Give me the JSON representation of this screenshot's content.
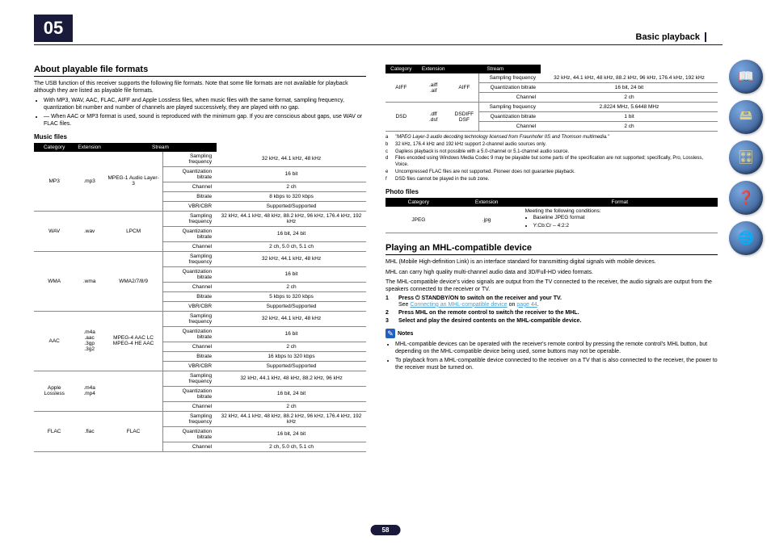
{
  "chapter": "05",
  "header_title": "Basic playback",
  "page_number": "58",
  "section1": {
    "title": "About playable file formats",
    "intro": "The USB function of this receiver supports the following file formats. Note that some file formats are not available for playback although they are listed as playable file formats.",
    "bullets": [
      "With MP3, WAV, AAC, FLAC, AIFF and Apple Lossless files, when music files with the same format, sampling frequency, quantization bit number and number of channels are played successively, they are played with no gap.",
      "When AAC or MP3 format is used, sound is reproduced with the minimum gap. If you are conscious about gaps, use WAV or FLAC files."
    ],
    "music_files": "Music files",
    "tbl_headers": {
      "cat": "Category",
      "ext": "Extension",
      "stream": "Stream",
      "format": "Format"
    },
    "labels": {
      "sf": "Sampling frequency",
      "qb": "Quantization bitrate",
      "ch": "Channel",
      "br": "Bitrate",
      "vc": "VBR/CBR"
    },
    "rows_left": [
      {
        "cat": "MP3\n<a>",
        "ext": ".mp3",
        "stream": "MPEG-1 Audio Layer-3",
        "d": [
          [
            "sf",
            "32 kHz, 44.1 kHz, 48 kHz"
          ],
          [
            "qb",
            "16 bit"
          ],
          [
            "ch",
            "2 ch"
          ],
          [
            "br",
            "8 kbps to 320 kbps"
          ],
          [
            "vc",
            "Supported/Supported"
          ]
        ]
      },
      {
        "cat": "WAV",
        "ext": ".wav",
        "stream": "LPCM",
        "d": [
          [
            "sf",
            "32 kHz, 44.1 kHz, 48 kHz, 88.2 kHz, 96 kHz, 176.4 kHz, 192 kHz"
          ],
          [
            "sf2",
            "<b>"
          ],
          [
            "qb",
            "16 bit, 24 bit"
          ],
          [
            "ch",
            "2 ch, 5.0 ch, 5.1 ch\n<c>"
          ]
        ]
      },
      {
        "cat": "WMA",
        "ext": ".wma",
        "stream": "WMA2/7/8/9\n<d>",
        "d": [
          [
            "sf",
            "32 kHz, 44.1 kHz, 48 kHz"
          ],
          [
            "qb",
            "16 bit"
          ],
          [
            "ch",
            "2 ch"
          ],
          [
            "br",
            "5 kbps to 320 kbps"
          ],
          [
            "vc",
            "Supported/Supported"
          ]
        ]
      },
      {
        "cat": "AAC",
        "ext": ".m4a\n.aac\n.3gp\n.3g2",
        "stream": "MPEG-4 AAC LC\nMPEG-4 HE AAC",
        "d": [
          [
            "sf",
            "32 kHz, 44.1 kHz, 48 kHz"
          ],
          [
            "qb",
            "16 bit"
          ],
          [
            "ch",
            "2 ch"
          ],
          [
            "br",
            "16 kbps to 320 kbps"
          ],
          [
            "vc",
            "Supported/Supported"
          ]
        ]
      },
      {
        "cat": "Apple Lossless",
        "ext": ".m4a\n.mp4",
        "stream": "",
        "d": [
          [
            "sf",
            "32 kHz, 44.1 kHz, 48 kHz, 88.2 kHz, 96 kHz"
          ],
          [
            "qb",
            "16 bit, 24 bit"
          ],
          [
            "ch",
            "2 ch"
          ]
        ]
      },
      {
        "cat": "FLAC\n<e>",
        "ext": ".flac",
        "stream": "FLAC",
        "d": [
          [
            "sf",
            "32 kHz, 44.1 kHz, 48 kHz, 88.2 kHz, 96 kHz, 176.4 kHz, 192 kHz"
          ],
          [
            "sf2",
            "<b>"
          ],
          [
            "qb",
            "16 bit, 24 bit"
          ],
          [
            "ch",
            "2 ch, 5.0 ch, 5.1 ch\n<c>"
          ]
        ]
      }
    ],
    "rows_right": [
      {
        "cat": "AIFF",
        "ext": ".aiff\n.aif",
        "stream": "AIFF",
        "d": [
          [
            "sf",
            "32 kHz, 44.1 kHz, 48 kHz, 88.2 kHz, 96 kHz, 176.4 kHz, 192 kHz"
          ],
          [
            "qb",
            "16 bit, 24 bit"
          ],
          [
            "ch",
            "2 ch"
          ]
        ]
      },
      {
        "cat": "DSD\n<f>",
        "ext": ".dff\n.dsf",
        "stream": "DSDIFF\nDSF",
        "d": [
          [
            "sf",
            "2.8224 MHz, 5.6448 MHz"
          ],
          [
            "qb",
            "1 bit"
          ],
          [
            "ch",
            "2 ch"
          ]
        ]
      }
    ],
    "footnotes": [
      [
        "a",
        "\"MPEG Layer-3 audio decoding technology licensed from Fraunhofer IIS and Thomson multimedia.\""
      ],
      [
        "b",
        "32 kHz, 176.4 kHz and 192 kHz support 2-channel audio sources only."
      ],
      [
        "c",
        "Gapless playback is not possible with a 5.0-channel or 5.1-channel audio source."
      ],
      [
        "d",
        "Files encoded using Windows Media Codec 9 may be playable but some parts of the specification are not supported; specifically, Pro, Lossless, Voice."
      ],
      [
        "e",
        "Uncompressed FLAC files are not supported. Pioneer does not guarantee playback."
      ],
      [
        "f",
        "DSD files cannot be played in the sub zone."
      ]
    ],
    "photo_files": "Photo files",
    "photo_row": {
      "cat": "JPEG",
      "ext": ".jpg",
      "fmt_intro": "Meeting the following conditions:",
      "fmt": [
        "Baseline JPEG format",
        "Y:Cb:Cr – 4:2:2"
      ]
    }
  },
  "section2": {
    "title": "Playing an MHL-compatible device",
    "p1": "MHL (Mobile High-definition Link) is an interface standard for transmitting digital signals with mobile devices.",
    "p2": "MHL can carry high quality multi-channel audio data and 3D/Full-HD video formats.",
    "p3": "The MHL-compatible device's video signals are output from the TV connected to the receiver, the audio signals are output from the speakers connected to the receiver or TV.",
    "steps": [
      {
        "n": "1",
        "t": "Press ⏻ STANDBY/ON to switch on the receiver and your TV.",
        "sub": "See Connecting an MHL-compatible device on page 44."
      },
      {
        "n": "2",
        "t": "Press MHL on the remote control to switch the receiver to the MHL."
      },
      {
        "n": "3",
        "t": "Select and play the desired contents on the MHL-compatible device."
      }
    ],
    "notes_label": "Notes",
    "notes": [
      "MHL-compatible devices can be operated with the receiver's remote control by pressing the remote control's MHL button, but depending on the MHL-compatible device being used, some buttons may not be operable.",
      "To playback from a MHL-compatible device connected to the receiver on a TV that is also connected to the receiver, the power to the receiver must be turned on."
    ]
  },
  "sidebar": [
    "book-icon",
    "hardware-icon",
    "remote-icon",
    "help-icon",
    "network-icon"
  ]
}
